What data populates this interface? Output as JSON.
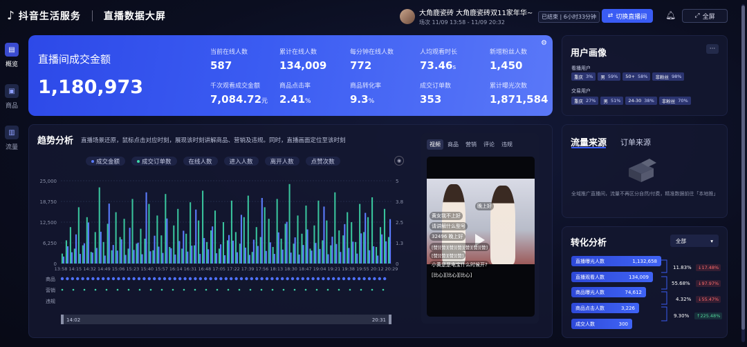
{
  "header": {
    "app_name": "抖音生活服务",
    "page_title": "直播数据大屏",
    "host_name": "大角鹿瓷砖 大角鹿瓷砖双11家年华~",
    "session_time": "场次 11/09 13:58 - 11/09 20:32",
    "status": "已结束 | 6小时33分钟",
    "switch_label": "切换直播间",
    "fullscreen_label": "全屏"
  },
  "nav": [
    {
      "label": "概览",
      "icon": "overview-icon",
      "active": true
    },
    {
      "label": "商品",
      "icon": "product-icon",
      "active": false
    },
    {
      "label": "流量",
      "icon": "traffic-icon",
      "active": false
    }
  ],
  "kpi": {
    "gmv_label": "直播间成交金额",
    "gmv_value": "1,180,973",
    "metrics": [
      {
        "label": "当前在线人数",
        "value": "587",
        "unit": ""
      },
      {
        "label": "累计在线人数",
        "value": "134,009",
        "unit": ""
      },
      {
        "label": "每分钟在线人数",
        "value": "772",
        "unit": ""
      },
      {
        "label": "人均观看时长",
        "value": "73.46",
        "unit": "s"
      },
      {
        "label": "新增粉丝人数",
        "value": "1,450",
        "unit": ""
      },
      {
        "label": "千次观看成交金额",
        "value": "7,084.72",
        "unit": "元"
      },
      {
        "label": "商品点击率",
        "value": "2.41",
        "unit": "%"
      },
      {
        "label": "商品转化率",
        "value": "9.3",
        "unit": "%"
      },
      {
        "label": "成交订单数",
        "value": "353",
        "unit": ""
      },
      {
        "label": "累计曝光次数",
        "value": "1,871,584",
        "unit": ""
      }
    ]
  },
  "trend": {
    "title": "趋势分析",
    "description": "直播场景还原，鼠标点击对应时刻，展现该时刻讲解商品、营销及违规。同时，直播画面定位至该时刻",
    "legend": [
      {
        "label": "成交金额",
        "color": "#5b7cff"
      },
      {
        "label": "成交订单数",
        "color": "#3ed6a8"
      },
      {
        "label": "在线人数",
        "color": ""
      },
      {
        "label": "进入人数",
        "color": ""
      },
      {
        "label": "离开人数",
        "color": ""
      },
      {
        "label": "点赞次数",
        "color": ""
      }
    ],
    "row_labels": [
      "商品",
      "营销",
      "违规"
    ],
    "range_start": "14:02",
    "range_end": "20:31"
  },
  "chart_data": {
    "type": "bar",
    "y_left_ticks": [
      "25,000",
      "18,750",
      "12,500",
      "6,250",
      "0"
    ],
    "y_right_ticks": [
      "5",
      "3.8",
      "2.5",
      "1.3",
      "0"
    ],
    "x_ticks": [
      "13:58",
      "14:15",
      "14:32",
      "14:49",
      "15:06",
      "15:23",
      "15:40",
      "15:57",
      "16:14",
      "16:31",
      "16:48",
      "17:05",
      "17:22",
      "17:39",
      "17:56",
      "18:13",
      "18:30",
      "18:47",
      "19:04",
      "19:21",
      "19:38",
      "19:55",
      "20:12",
      "20:29"
    ],
    "ylim": [
      0,
      25000
    ],
    "y2lim": [
      0,
      5
    ],
    "series": [
      {
        "name": "成交金额",
        "values": [
          2100,
          5200,
          3400,
          8800,
          2900,
          6100,
          12400,
          3300,
          4700,
          9600,
          2400,
          18100,
          5600,
          3900,
          7300,
          2600,
          10800,
          4100,
          6300,
          2800,
          21500,
          3700,
          8400,
          5100,
          3200,
          13600,
          4600,
          2700,
          6800,
          9900,
          3600,
          5400,
          16300,
          2900,
          7700,
          4300,
          11200,
          3100,
          5800,
          2500,
          8600,
          6900,
          3400,
          14700,
          4800,
          2600,
          7200,
          5300,
          19800,
          3800,
          6400,
          2900,
          9400,
          4200,
          12600,
          3300,
          7900,
          2700,
          5600,
          10300,
          3900,
          6200,
          4400,
          17200,
          2800,
          8100,
          5900,
          3500,
          11900,
          4700,
          6600,
          3000,
          9100,
          15300,
          4000,
          5200,
          2400,
          8800,
          6700,
          13400
        ]
      },
      {
        "name": "成交订单数",
        "values": [
          0.6,
          1.4,
          2.2,
          0.9,
          3.4,
          1.1,
          2.8,
          0.7,
          1.9,
          4.6,
          1.3,
          2.4,
          0.8,
          3.1,
          1.6,
          2.7,
          0.9,
          3.9,
          1.2,
          2.1,
          1.5,
          3.6,
          0.8,
          2.9,
          1.7,
          4.2,
          1.0,
          2.3,
          3.3,
          0.9,
          1.8,
          3.7,
          1.1,
          2.6,
          4.4,
          1.3,
          2.0,
          3.2,
          0.9,
          2.5,
          1.4,
          3.8,
          1.9,
          1.2,
          2.8,
          4.1,
          0.7,
          2.2,
          1.6,
          3.4,
          2.7,
          1.0,
          3.9,
          1.5,
          2.4,
          4.8,
          1.2,
          2.9,
          1.8,
          3.5,
          0.9,
          2.3,
          3.8,
          1.4,
          2.6,
          1.1,
          4.3,
          2.0,
          1.7,
          3.1,
          2.5,
          1.3,
          3.6,
          1.9,
          2.8,
          4.0,
          1.0,
          2.2,
          3.3,
          1.6
        ]
      }
    ]
  },
  "video": {
    "tabs": [
      "视频",
      "商品",
      "营销",
      "评论",
      "违规"
    ],
    "active_tab": "视频",
    "chat": [
      "晚上好",
      "黄女我不上好",
      "请讲解什么型号",
      "32496 晚上好",
      "[赞][赞][赞][赞][赞][赞][赞]",
      "[赞][赞][赞][赞]",
      "小黄是是电宝什么时候开?",
      "[比心][比心][比心]"
    ]
  },
  "user_portrait": {
    "title": "用户画像",
    "watch_label": "看播用户",
    "watch_tags": [
      {
        "name": "重庆",
        "pct": "3%"
      },
      {
        "name": "男",
        "pct": "59%"
      },
      {
        "name": "50+",
        "pct": "58%"
      },
      {
        "name": "非粉丝",
        "pct": "98%"
      }
    ],
    "trade_label": "交易用户",
    "trade_tags": [
      {
        "name": "重庆",
        "pct": "27%"
      },
      {
        "name": "男",
        "pct": "51%"
      },
      {
        "name": "24-30",
        "pct": "38%"
      },
      {
        "name": "非粉丝",
        "pct": "70%"
      }
    ]
  },
  "traffic": {
    "tab_active": "流量来源",
    "tab_inactive": "订单来源",
    "empty_text": "全域推广直播间，流量不再区分自然/付费，精准数据前往「本地推」"
  },
  "conversion": {
    "title": "转化分析",
    "select_value": "全部",
    "stages": [
      {
        "label": "直播曝光人数",
        "value": "1,132,658"
      },
      {
        "label": "直播观看人数",
        "value": "134,009"
      },
      {
        "label": "商品曝光人数",
        "value": "74,612"
      },
      {
        "label": "商品点击人数",
        "value": "3,226"
      },
      {
        "label": "成交人数",
        "value": "300"
      }
    ],
    "rates": [
      {
        "rate": "11.83%",
        "change": "↓17.48%",
        "dir": "down"
      },
      {
        "rate": "55.68%",
        "change": "↓97.97%",
        "dir": "down"
      },
      {
        "rate": "4.32%",
        "change": "↓55.47%",
        "dir": "down"
      },
      {
        "rate": "9.30%",
        "change": "↑225.48%",
        "dir": "up"
      }
    ]
  }
}
